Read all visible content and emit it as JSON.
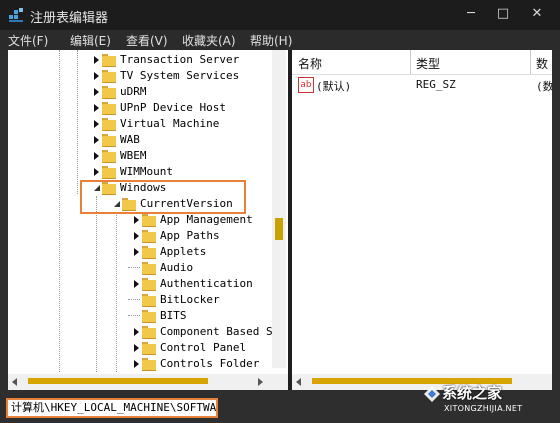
{
  "window": {
    "title": "注册表编辑器",
    "controls": {
      "minimize": "─",
      "maximize": "□",
      "close": "✕"
    }
  },
  "menu": [
    "文件(F)",
    "编辑(E)",
    "查看(V)",
    "收藏夹(A)",
    "帮助(H)"
  ],
  "tree": {
    "items": [
      {
        "label": "Transaction Server",
        "expander": "collapsed"
      },
      {
        "label": "TV System Services",
        "expander": "collapsed"
      },
      {
        "label": "uDRM",
        "expander": "collapsed"
      },
      {
        "label": "UPnP Device Host",
        "expander": "collapsed"
      },
      {
        "label": "Virtual Machine",
        "expander": "collapsed"
      },
      {
        "label": "WAB",
        "expander": "collapsed"
      },
      {
        "label": "WBEM",
        "expander": "collapsed"
      },
      {
        "label": "WIMMount",
        "expander": "collapsed"
      },
      {
        "label": "Windows",
        "expander": "expanded"
      },
      {
        "label": "CurrentVersion",
        "expander": "expanded"
      },
      {
        "label": "App Management",
        "expander": "collapsed"
      },
      {
        "label": "App Paths",
        "expander": "collapsed"
      },
      {
        "label": "Applets",
        "expander": "collapsed"
      },
      {
        "label": "Audio",
        "expander": "none"
      },
      {
        "label": "Authentication",
        "expander": "collapsed"
      },
      {
        "label": "BitLocker",
        "expander": "none"
      },
      {
        "label": "BITS",
        "expander": "none"
      },
      {
        "label": "Component Based S",
        "expander": "collapsed"
      },
      {
        "label": "Control Panel",
        "expander": "collapsed"
      },
      {
        "label": "Controls Folder",
        "expander": "collapsed"
      }
    ]
  },
  "list": {
    "columns": [
      "名称",
      "类型",
      "数"
    ],
    "rows": [
      {
        "icon": "ab",
        "name": "(默认)",
        "type": "REG_SZ",
        "data": "(数"
      }
    ]
  },
  "status": {
    "path": "计算机\\HKEY_LOCAL_MACHINE\\SOFTWARE"
  },
  "watermark": {
    "text": "系统之家",
    "url": "XITONGZHIJIA.NET"
  },
  "colors": {
    "highlight": "#e8823a",
    "scroll_thumb": "#d8a400",
    "folder": "#f2c84b"
  }
}
